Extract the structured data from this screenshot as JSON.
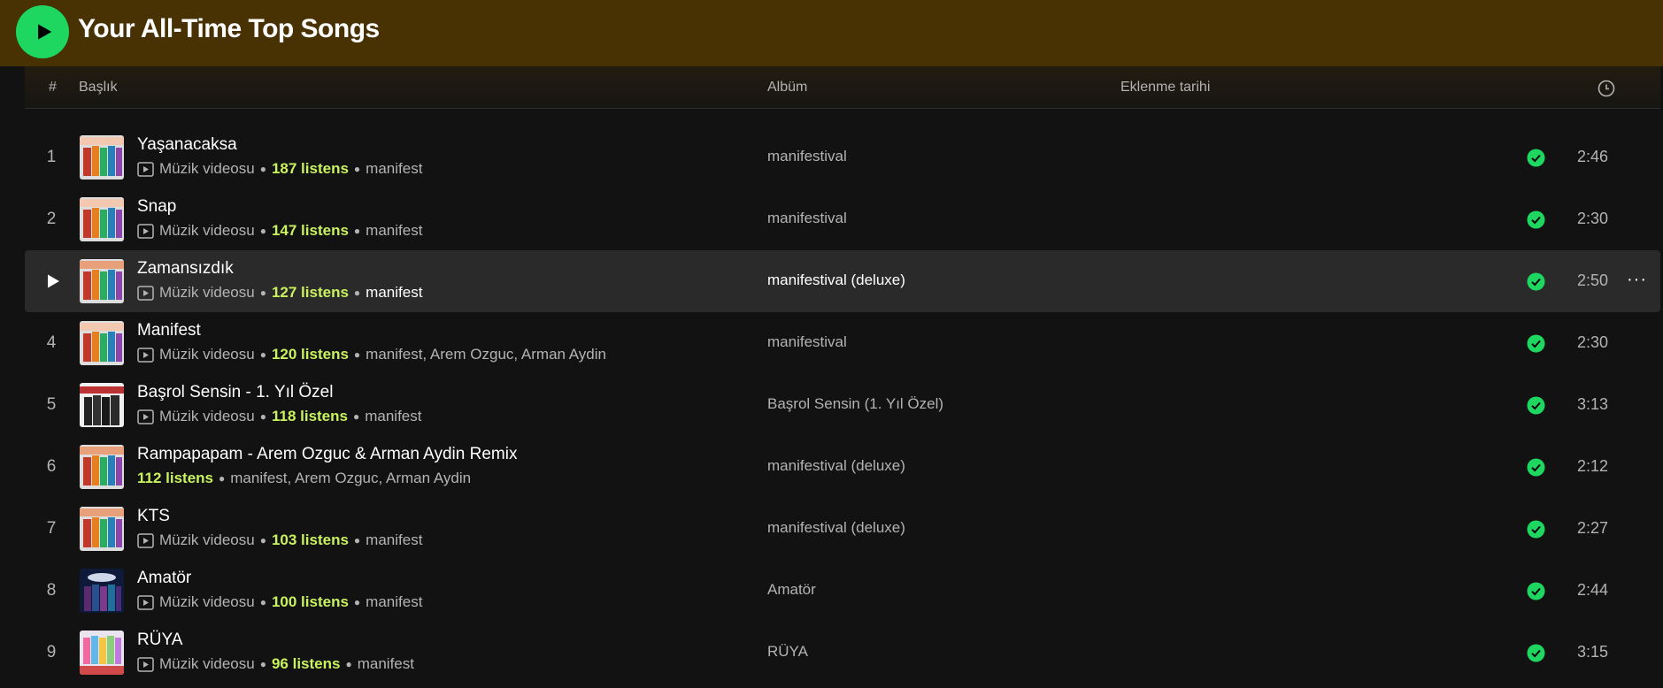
{
  "header": {
    "title": "Your All-Time Top Songs",
    "accent_color": "#1ed760",
    "background_color": "#483102"
  },
  "columns": {
    "number": "#",
    "title": "Başlık",
    "album": "Albüm",
    "date_added": "Eklenme tarihi",
    "duration_icon": "clock-icon"
  },
  "tracks": [
    {
      "index": "1",
      "title": "Yaşanacaksa",
      "type": "Müzik videosu",
      "listens": "187 listens",
      "artists": "manifest",
      "album": "manifestival",
      "duration": "2:46"
    },
    {
      "index": "2",
      "title": "Snap",
      "type": "Müzik videosu",
      "listens": "147 listens",
      "artists": "manifest",
      "album": "manifestival",
      "duration": "2:30"
    },
    {
      "index": "3",
      "title": "Zamansızdık",
      "type": "Müzik videosu",
      "listens": "127 listens",
      "artists": "manifest",
      "album": "manifestival (deluxe)",
      "duration": "2:50",
      "more": "···"
    },
    {
      "index": "4",
      "title": "Manifest",
      "type": "Müzik videosu",
      "listens": "120 listens",
      "artists": "manifest, Arem Ozguc, Arman Aydin",
      "album": "manifestival",
      "duration": "2:30"
    },
    {
      "index": "5",
      "title": "Başrol Sensin - 1. Yıl Özel",
      "type": "Müzik videosu",
      "listens": "118 listens",
      "artists": "manifest",
      "album": "Başrol Sensin (1. Yıl Özel)",
      "duration": "3:13"
    },
    {
      "index": "6",
      "title": "Rampapapam - Arem Ozguc & Arman Aydin Remix",
      "listens": "112 listens",
      "artists": "manifest, Arem Ozguc, Arman Aydin",
      "album": "manifestival (deluxe)",
      "duration": "2:12"
    },
    {
      "index": "7",
      "title": "KTS",
      "type": "Müzik videosu",
      "listens": "103 listens",
      "artists": "manifest",
      "album": "manifestival (deluxe)",
      "duration": "2:27"
    },
    {
      "index": "8",
      "title": "Amatör",
      "type": "Müzik videosu",
      "listens": "100 listens",
      "artists": "manifest",
      "album": "Amatör",
      "duration": "2:44"
    },
    {
      "index": "9",
      "title": "RÜYA",
      "type": "Müzik videosu",
      "listens": "96 listens",
      "artists": "manifest",
      "album": "RÜYA",
      "duration": "3:15"
    }
  ],
  "colors": {
    "listens": "#c9f25e",
    "saved_check": "#1ed760"
  }
}
